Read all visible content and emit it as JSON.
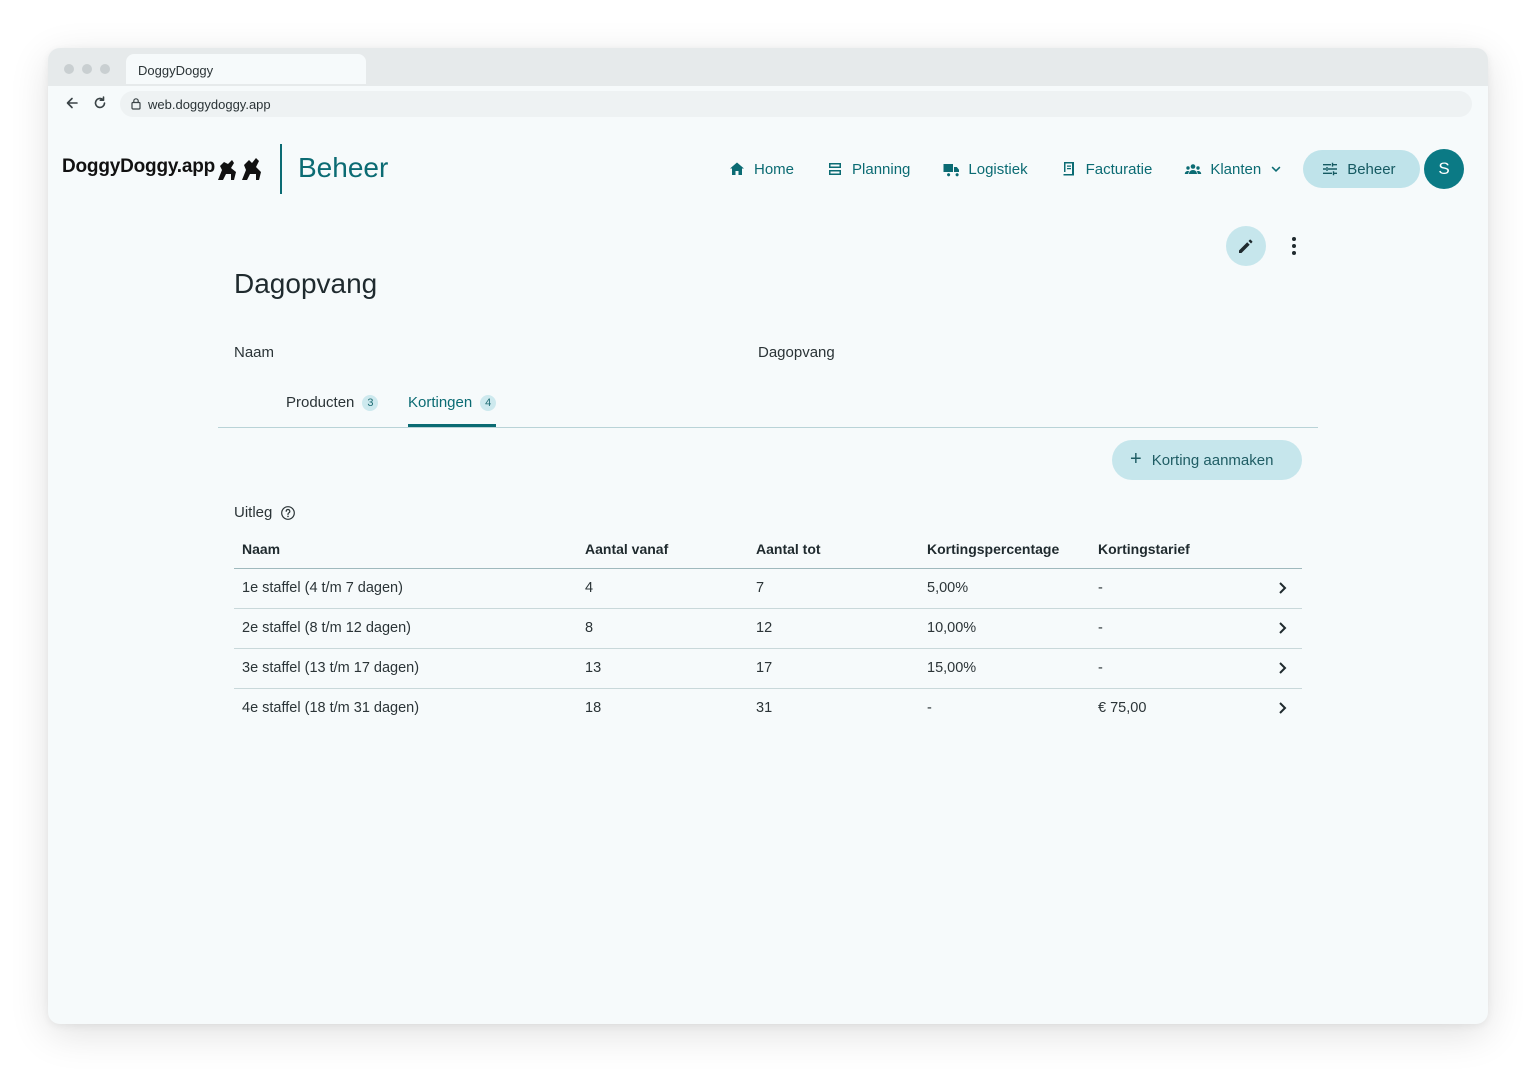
{
  "browser": {
    "tab_title": "DoggyDoggy",
    "url": "web.doggydoggy.app"
  },
  "header": {
    "logo": "DoggyDoggy.app",
    "section": "Beheer",
    "nav": [
      {
        "label": "Home",
        "icon": "home-icon"
      },
      {
        "label": "Planning",
        "icon": "planning-icon"
      },
      {
        "label": "Logistiek",
        "icon": "truck-icon"
      },
      {
        "label": "Facturatie",
        "icon": "invoice-icon"
      },
      {
        "label": "Klanten",
        "icon": "people-icon"
      },
      {
        "label": "Beheer",
        "icon": "sliders-icon"
      }
    ],
    "avatar": "S"
  },
  "page": {
    "title": "Dagopvang",
    "field_label": "Naam",
    "field_value": "Dagopvang",
    "tabs": [
      {
        "label": "Producten",
        "count": "3"
      },
      {
        "label": "Kortingen",
        "count": "4"
      }
    ],
    "add_button": "Korting aanmaken",
    "uitleg": "Uitleg"
  },
  "table": {
    "headers": [
      "Naam",
      "Aantal vanaf",
      "Aantal tot",
      "Kortingspercentage",
      "Kortingstarief"
    ],
    "rows": [
      [
        "1e staffel (4 t/m 7 dagen)",
        "4",
        "7",
        "5,00%",
        "-"
      ],
      [
        "2e staffel (8 t/m 12 dagen)",
        "8",
        "12",
        "10,00%",
        "-"
      ],
      [
        "3e staffel (13 t/m 17 dagen)",
        "13",
        "17",
        "15,00%",
        "-"
      ],
      [
        "4e staffel (18 t/m 31 dagen)",
        "18",
        "31",
        "-",
        "€ 75,00"
      ]
    ]
  },
  "colors": {
    "accent": "#0b6b73",
    "accent_light": "#c6e6ec",
    "background": "#f6fafb"
  }
}
